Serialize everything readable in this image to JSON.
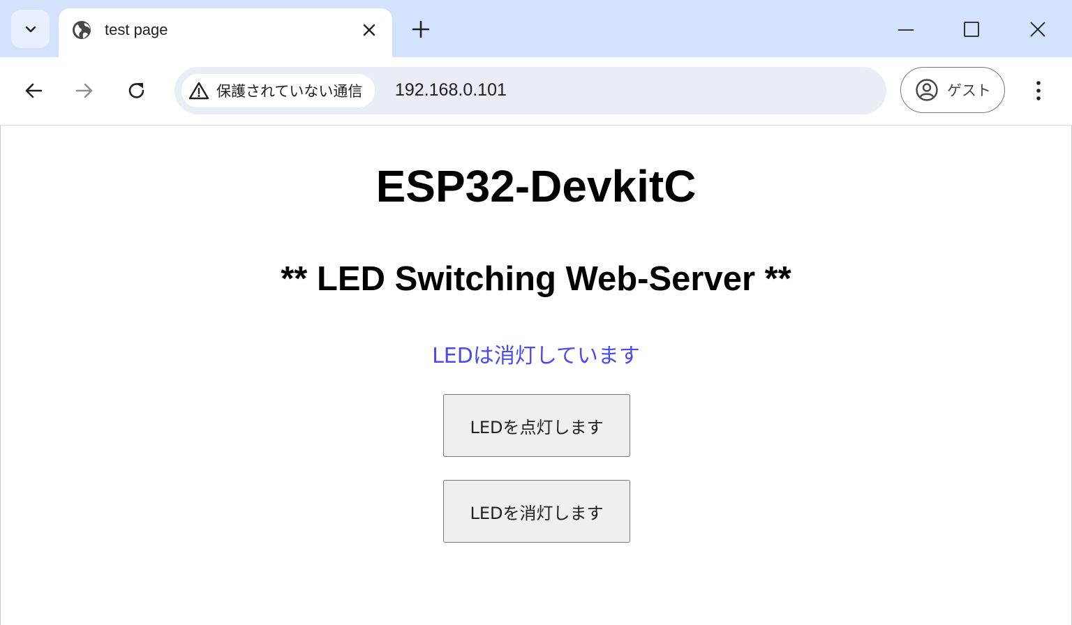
{
  "browser": {
    "tab": {
      "title": "test page"
    },
    "address_bar": {
      "security_label": "保護されていない通信",
      "url": "192.168.0.101"
    },
    "profile": {
      "label": "ゲスト"
    }
  },
  "icons": [
    "chevron-down-icon",
    "globe-icon",
    "close-icon",
    "plus-icon",
    "minimize-icon",
    "maximize-icon",
    "window-close-icon",
    "back-arrow-icon",
    "forward-arrow-icon",
    "reload-icon",
    "warning-icon",
    "account-icon",
    "more-vert-icon"
  ],
  "colors": {
    "tabstrip": "#d3e3fd",
    "omnibox": "#e9eef6",
    "status_text": "#4a4af0",
    "button_bg": "#efefef"
  },
  "page": {
    "heading": "ESP32-DevkitC",
    "subheading": "** LED Switching Web-Server **",
    "status": "LEDは消灯しています",
    "buttons": {
      "on": "LEDを点灯します",
      "off": "LEDを消灯します"
    }
  }
}
